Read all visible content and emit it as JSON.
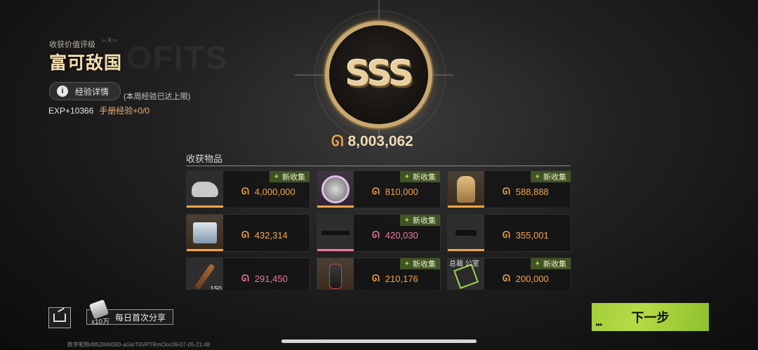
{
  "header": {
    "rating_label": "收获价值评级",
    "rating_title": "富可敌国",
    "exp_button": "经验详情",
    "week_note": "(本周经验已达上限)",
    "exp": "EXP+10366",
    "book_exp": "手册经验+0/0"
  },
  "emblem": {
    "grade": "SSS"
  },
  "total": {
    "currency_icon": "coin-icon",
    "value": "8,003,062"
  },
  "items_section": {
    "title": "收获物品"
  },
  "items": [
    {
      "icon": "rhino-icon",
      "price": "4,000,000",
      "color": "orange",
      "new": "新收集"
    },
    {
      "icon": "medal-icon",
      "price": "810,000",
      "color": "orange",
      "new": "新收集"
    },
    {
      "icon": "statue-icon",
      "price": "588,888",
      "color": "orange",
      "new": "新收集"
    },
    {
      "icon": "server-box-icon",
      "price": "432,314",
      "color": "orange",
      "new": ""
    },
    {
      "icon": "rifle-icon",
      "price": "420,030",
      "color": "pink",
      "new": "新收集"
    },
    {
      "icon": "smg-icon",
      "price": "355,001",
      "color": "orange",
      "new": ""
    },
    {
      "icon": "bullet-icon",
      "price": "291,450",
      "color": "pink",
      "new": "",
      "count": "150"
    },
    {
      "icon": "canister-icon",
      "price": "210,176",
      "color": "orange",
      "new": "新收集"
    },
    {
      "icon": "keycard-icon",
      "price": "200,000",
      "color": "orange",
      "new": "新收集",
      "overlay": "总裁 公室"
    }
  ],
  "footer": {
    "share_multiplier": "x10万",
    "daily_share": "每日首次分享",
    "next": "下一步",
    "uid": "数字昵称4852849393-aGkrT6VPTRmOoc09-07-05-21:48"
  }
}
